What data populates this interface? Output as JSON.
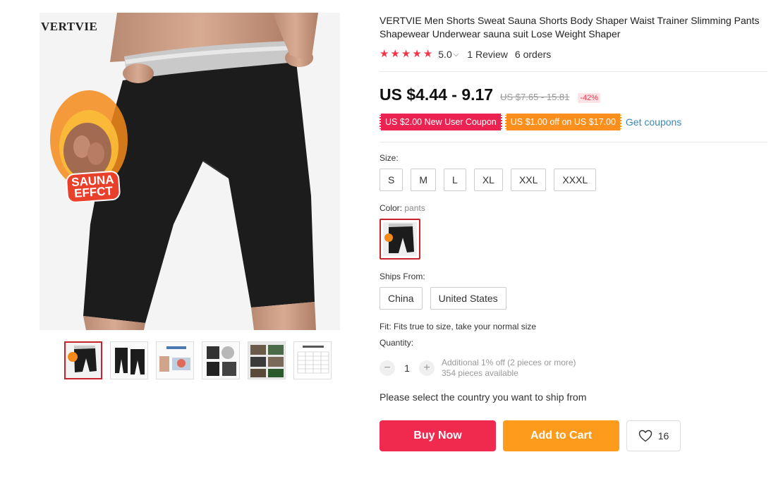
{
  "gallery": {
    "brand": "VERTVIE",
    "badge_text": "SAUNA EFFCT",
    "thumbnails": [
      "thumb-1",
      "thumb-2",
      "thumb-3",
      "thumb-4",
      "thumb-5",
      "thumb-6"
    ]
  },
  "product": {
    "title": "VERTVIE Men Shorts Sweat Sauna Shorts Body Shaper Waist Trainer Slimming Pants Shapewear Underwear sauna suit Lose Weight Shaper",
    "rating": {
      "stars": 5,
      "score": "5.0",
      "reviews": "1 Review",
      "orders": "6 orders"
    },
    "price": {
      "current": "US $4.44 - 9.17",
      "original": "US $7.65 - 15.81",
      "discount": "-42%"
    },
    "coupons": {
      "new_user": "US $2.00 New User Coupon",
      "store": "US $1.00 off on US $17.00",
      "get_link": "Get coupons"
    },
    "size": {
      "label": "Size:",
      "options": [
        "S",
        "M",
        "L",
        "XL",
        "XXL",
        "XXXL"
      ]
    },
    "color": {
      "label": "Color:",
      "selected": "pants"
    },
    "ships_from": {
      "label": "Ships From:",
      "options": [
        "China",
        "United States"
      ]
    },
    "fit": "Fit: Fits true to size, take your normal size",
    "quantity": {
      "label": "Quantity:",
      "value": "1",
      "minus": "−",
      "plus": "+",
      "discount_note": "Additional 1% off (2 pieces or more)",
      "available": "354 pieces available"
    },
    "ship_note": "Please select the country you want to ship from",
    "actions": {
      "buy_now": "Buy Now",
      "add_to_cart": "Add to Cart",
      "wishlist_count": "16"
    }
  },
  "colors": {
    "accent_red": "#f0294f",
    "accent_orange": "#fc9b1c",
    "star": "#f0364d",
    "link": "#3a88b8"
  }
}
